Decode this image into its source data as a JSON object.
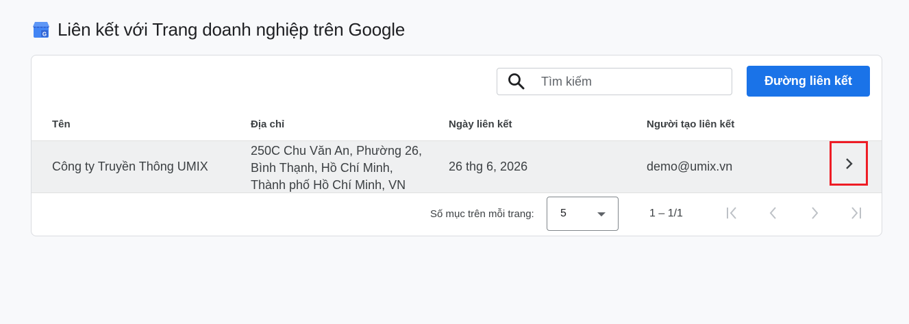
{
  "page": {
    "title": "Liên kết với Trang doanh nghiệp trên Google"
  },
  "toolbar": {
    "search_placeholder": "Tìm kiếm",
    "link_button_label": "Đường liên kết"
  },
  "table": {
    "columns": [
      "Tên",
      "Địa chỉ",
      "Ngày liên kết",
      "Người tạo liên kết"
    ],
    "rows": [
      {
        "name": "Công ty Truyền Thông UMIX",
        "address_lines": [
          "250C Chu Văn An, Phường 26,",
          "Bình Thạnh, Hồ Chí Minh,",
          "Thành phố Hồ Chí Minh, VN"
        ],
        "date": "26 thg 6, 2026",
        "creator": "demo@umix.vn"
      }
    ]
  },
  "paginator": {
    "items_per_page_label": "Số mục trên mỗi trang:",
    "items_per_page_value": "5",
    "range_label": "1 – 1/1"
  },
  "colors": {
    "primary": "#1a73e8",
    "highlight_border": "#ee1c25",
    "row_background": "#eff0f1",
    "page_background": "#f8f9fb"
  },
  "icons": {
    "logo": "google-business-profile-icon",
    "search": "search-icon",
    "row_action": "chevron-right-icon",
    "dropdown": "caret-down-icon",
    "first_page": "first-page-icon",
    "prev_page": "chevron-left-icon",
    "next_page": "chevron-right-icon",
    "last_page": "last-page-icon"
  }
}
